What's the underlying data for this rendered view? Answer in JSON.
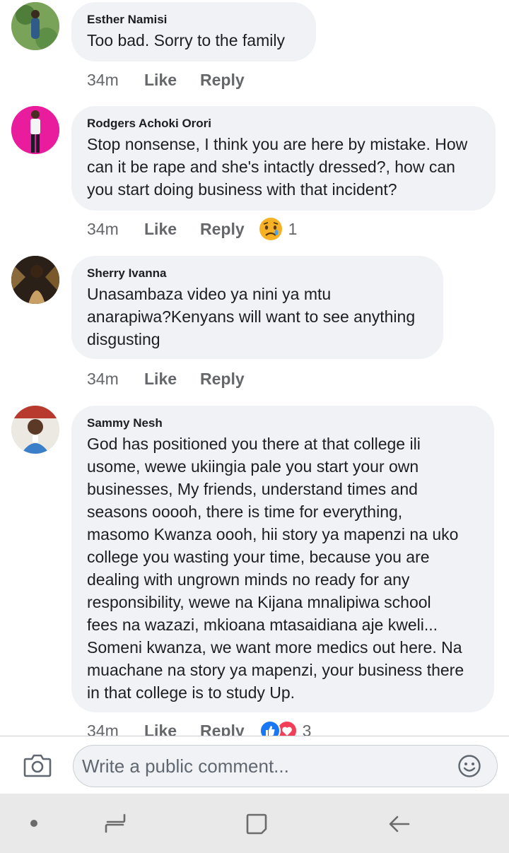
{
  "comments": [
    {
      "author": "Esther Namisi",
      "lines": [
        "Too bad. Sorry to the family"
      ],
      "time": "34m",
      "like": "Like",
      "reply": "Reply"
    },
    {
      "author": "Rodgers Achoki Orori",
      "lines": [
        "Stop nonsense, I think you are here by mistake. How",
        "can it be rape and she's intactly dressed?, how can",
        "you start doing business with that incident?"
      ],
      "time": "34m",
      "like": "Like",
      "reply": "Reply",
      "reaction_count": "1"
    },
    {
      "author": "Sherry Ivanna",
      "lines": [
        "Unasambaza video ya nini ya mtu",
        "anarapiwa?Kenyans will want to see anything",
        "disgusting"
      ],
      "time": "34m",
      "like": "Like",
      "reply": "Reply"
    },
    {
      "author": "Sammy Nesh",
      "lines": [
        "God has positioned you there at that college ili",
        "usome, wewe ukiingia pale you start your own",
        "businesses, My friends, understand times and",
        "seasons ooooh, there is time for everything,",
        "masomo Kwanza oooh, hii story ya mapenzi na uko",
        "college you wasting your time, because you are",
        "dealing with ungrown minds no ready for any",
        "responsibility, wewe na Kijana mnalipiwa school",
        "fees na wazazi, mkioana mtasaidiana aje kweli...",
        "Someni kwanza, we want more medics out here. Na",
        "muachane na story ya mapenzi, your business there",
        "in that college is to study Up."
      ],
      "time": "34m",
      "like": "Like",
      "reply": "Reply",
      "reaction_count": "3"
    }
  ],
  "composer": {
    "placeholder": "Write a public comment..."
  },
  "icons": {
    "camera": "camera-icon",
    "emoji": "smiley-icon",
    "recent": "recent-apps-icon",
    "home": "home-icon",
    "back": "back-icon"
  },
  "colors": {
    "bubble": "#f0f2f5",
    "meta": "#65676b",
    "like_blue": "#1877f2",
    "love_red": "#f33e58",
    "navbar": "#e9e9e9"
  }
}
